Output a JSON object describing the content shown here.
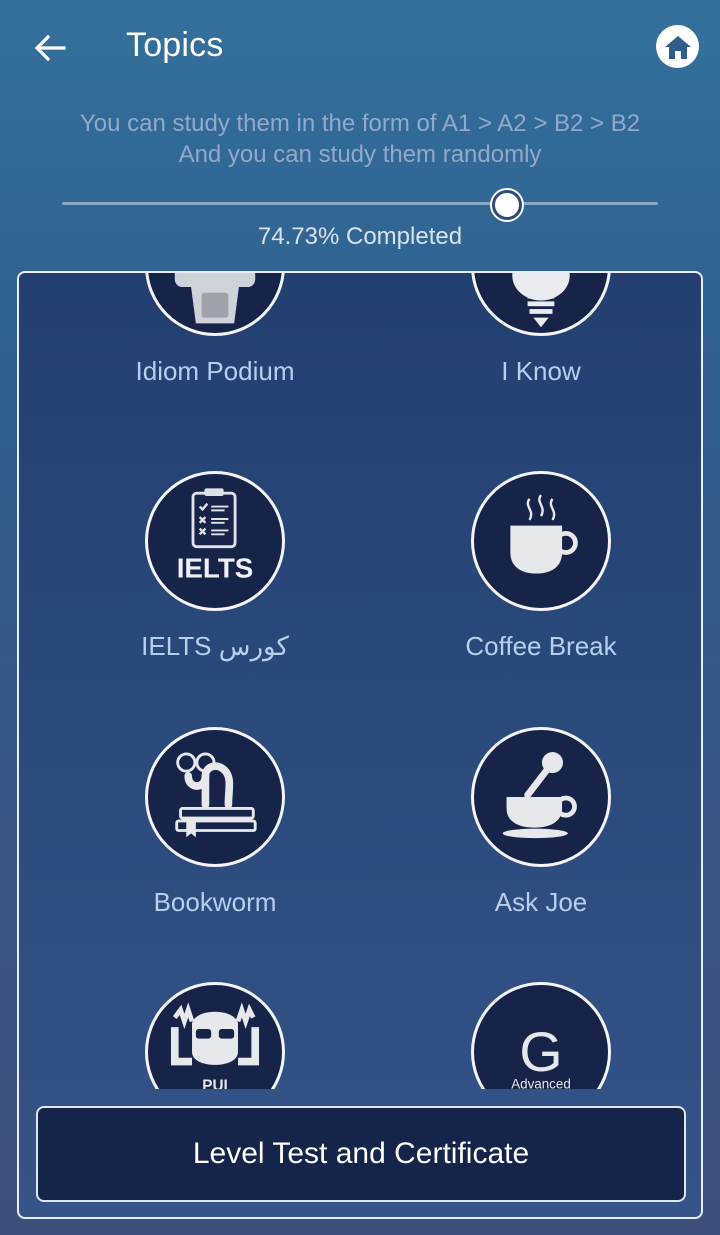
{
  "header": {
    "title": "Topics",
    "back_icon": "arrow-left-icon",
    "home_icon": "home-icon"
  },
  "subtitle": "You can study them in the form of A1 > A2 > B2 > B2 And you can study them randomly",
  "progress": {
    "percent": 74.73,
    "text": "74.73% Completed"
  },
  "topics": [
    {
      "label": "Idiom Podium",
      "icon": "podium-icon"
    },
    {
      "label": "I Know",
      "icon": "lightbulb-icon"
    },
    {
      "label": "IELTS کورس",
      "icon": "ielts-checklist-icon",
      "icon_text": "IELTS"
    },
    {
      "label": "Coffee Break",
      "icon": "coffee-cup-icon"
    },
    {
      "label": "Bookworm",
      "icon": "bookworm-icon"
    },
    {
      "label": "Ask Joe",
      "icon": "cup-microphone-icon"
    },
    {
      "label": "",
      "icon": "guy-with-glasses-icon",
      "icon_text": "PUI"
    },
    {
      "label": "",
      "icon": "grammar-advanced-icon",
      "icon_text": "G",
      "icon_subtext": "Advanced"
    }
  ],
  "cta": {
    "label": "Level Test and Certificate"
  },
  "colors": {
    "background_top": "#34709c",
    "background_bottom": "#3f4f7c",
    "panel": "#223f70",
    "circle": "#16244a",
    "label": "#b8d0ee",
    "button": "#15244a"
  }
}
